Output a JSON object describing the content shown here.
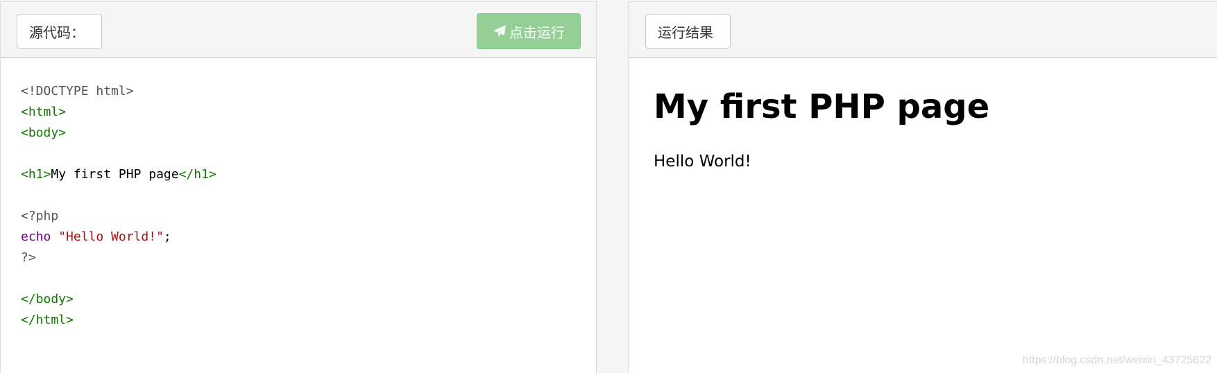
{
  "source_panel": {
    "header_label": "源代码：",
    "run_button_label": "点击运行",
    "run_button_icon": "paper-plane-icon"
  },
  "code": {
    "lines": [
      [
        {
          "t": "<!DOCTYPE html>",
          "k": "meta"
        }
      ],
      [
        {
          "t": "<html>",
          "k": "tag"
        }
      ],
      [
        {
          "t": "<body>",
          "k": "tag"
        }
      ],
      [],
      [
        {
          "t": "<h1>",
          "k": "tag"
        },
        {
          "t": "My first PHP page",
          "k": "text"
        },
        {
          "t": "</h1>",
          "k": "tag"
        }
      ],
      [],
      [
        {
          "t": "<?php",
          "k": "meta"
        }
      ],
      [
        {
          "t": "echo",
          "k": "kw"
        },
        {
          "t": " ",
          "k": "text"
        },
        {
          "t": "\"Hello World!\"",
          "k": "str"
        },
        {
          "t": ";",
          "k": "punct"
        }
      ],
      [
        {
          "t": "?>",
          "k": "meta"
        }
      ],
      [],
      [
        {
          "t": "</body>",
          "k": "tag"
        }
      ],
      [
        {
          "t": "</html>",
          "k": "tag"
        }
      ]
    ]
  },
  "result_panel": {
    "header_label": "运行结果",
    "output_heading": "My first PHP page",
    "output_text": "Hello World!"
  },
  "watermark": "https://blog.csdn.net/weixin_43725622",
  "colors": {
    "run_button": "#94d096",
    "code_tag": "#117700",
    "code_keyword": "#770088",
    "code_string": "#aa1111",
    "code_meta": "#555555"
  }
}
